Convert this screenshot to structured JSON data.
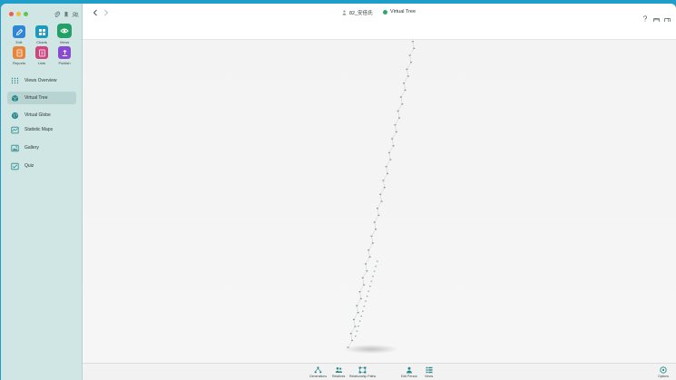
{
  "window": {
    "breadcrumb_person": "82_安倍氏",
    "breadcrumb_view": "Virtual Tree"
  },
  "modes": [
    {
      "label": "Edit",
      "icon": "pencil-icon",
      "color": "#2f86d6"
    },
    {
      "label": "Charts",
      "icon": "charts-icon",
      "color": "#1a9bbd"
    },
    {
      "label": "Views",
      "icon": "eye-icon",
      "color": "#22a065"
    },
    {
      "label": "Reports",
      "icon": "reports-icon",
      "color": "#e7833a"
    },
    {
      "label": "Lists",
      "icon": "lists-icon",
      "color": "#d0457f"
    },
    {
      "label": "Publish",
      "icon": "publish-icon",
      "color": "#8a4ad0"
    }
  ],
  "sidebar": {
    "items": [
      {
        "label": "Views Overview",
        "icon": "grid-dots-icon"
      },
      {
        "label": "Virtual Tree",
        "icon": "cube-icon"
      },
      {
        "label": "Virtual Globe",
        "icon": "globe-icon"
      },
      {
        "label": "Statistic Maps",
        "icon": "map-icon"
      },
      {
        "label": "Gallery",
        "icon": "gallery-icon"
      },
      {
        "label": "Quiz",
        "icon": "quiz-icon"
      }
    ]
  },
  "bottombar": {
    "generations": "Generations",
    "relatives": "Relatives",
    "relationship_paths": "Relationship Paths",
    "edit_person": "Edit Person",
    "views": "Views",
    "options": "Options"
  },
  "colors": {
    "accent": "#22a065",
    "desktop": "#1f9ec9",
    "sidebar": "#cfe6e5"
  }
}
